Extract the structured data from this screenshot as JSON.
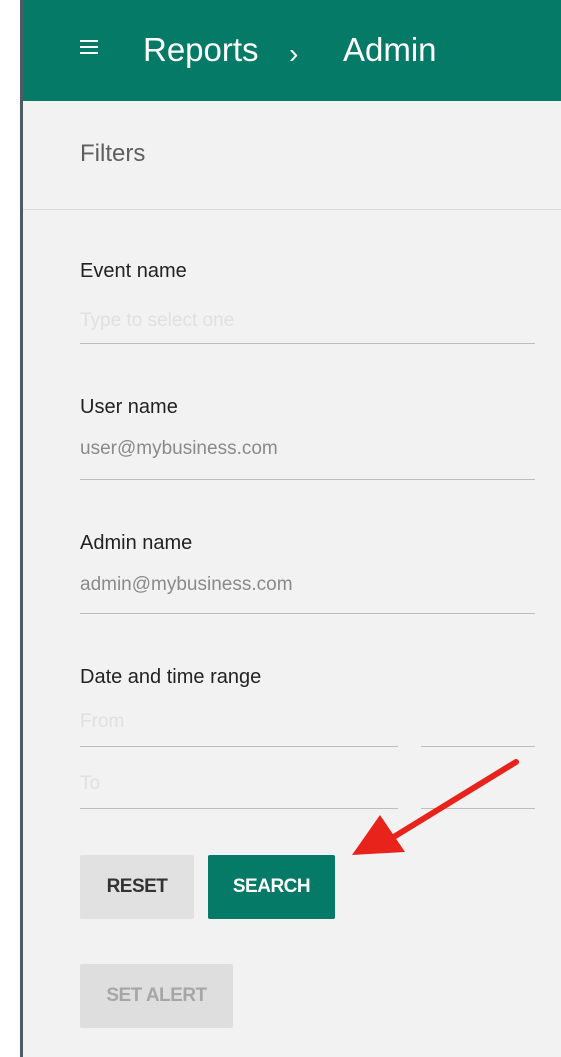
{
  "header": {
    "breadcrumb": [
      "Reports",
      "Admin"
    ],
    "separator": "›"
  },
  "filters": {
    "title": "Filters",
    "event_name": {
      "label": "Event name",
      "placeholder": "Type to select one"
    },
    "user_name": {
      "label": "User name",
      "value": "user@mybusiness.com"
    },
    "admin_name": {
      "label": "Admin name",
      "value": "admin@mybusiness.com"
    },
    "date_range": {
      "label": "Date and time range",
      "from_placeholder": "From",
      "to_placeholder": "To"
    }
  },
  "buttons": {
    "reset": "RESET",
    "search": "SEARCH",
    "set_alert": "SET ALERT"
  },
  "colors": {
    "header": "#057a66",
    "panel": "#f2f2f2",
    "annotation_arrow": "#e8231c"
  },
  "icons": {
    "menu": "hamburger-menu-icon",
    "breadcrumb_separator": "chevron-right-icon"
  }
}
